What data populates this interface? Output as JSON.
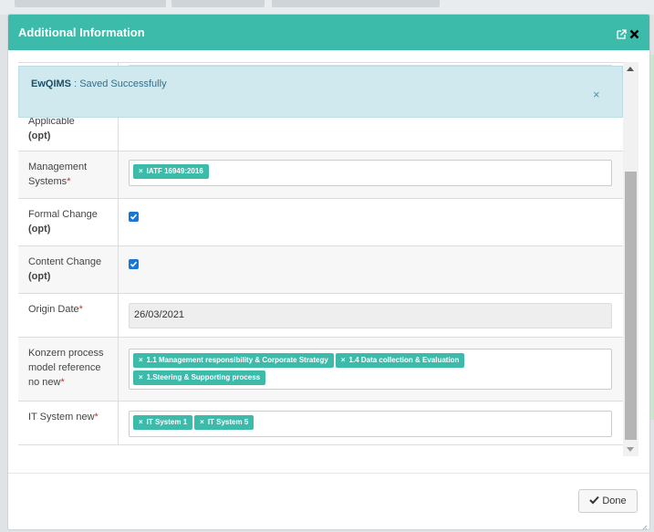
{
  "modal": {
    "title": "Additional Information",
    "external_icon": "external-link-icon",
    "close_icon": "close-icon"
  },
  "alert": {
    "app": "EwQIMS",
    "separator": " : ",
    "message": "Saved Successfully",
    "close_glyph": "×"
  },
  "rows": {
    "applicable": {
      "label": "Applicable",
      "opt": "(opt)"
    },
    "management_systems": {
      "label": "Management Systems",
      "req": "*",
      "tags": [
        "IATF 16949:2016"
      ]
    },
    "formal_change": {
      "label": "Formal Change",
      "opt": "(opt)",
      "checked": true
    },
    "content_change": {
      "label": "Content Change",
      "opt": "(opt)",
      "checked": true
    },
    "origin_date": {
      "label": "Origin Date",
      "req": "*",
      "value": "26/03/2021"
    },
    "konzern": {
      "label": "Konzern process model reference no new",
      "req": "*",
      "tags": [
        "1.1 Management responsibility & Corporate Strategy",
        "1.4 Data collection & Evaluation",
        "1.Steering & Supporting process"
      ]
    },
    "it_system": {
      "label": "IT System new",
      "req": "*",
      "tags": [
        "IT System 1",
        "IT System 5"
      ]
    }
  },
  "tag_remove_glyph": "×",
  "footer": {
    "done_label": "Done"
  },
  "colors": {
    "header": "#3cbbaa",
    "tag": "#3cbbaa",
    "checkbox": "#1976d2",
    "required": "#c0392b"
  }
}
